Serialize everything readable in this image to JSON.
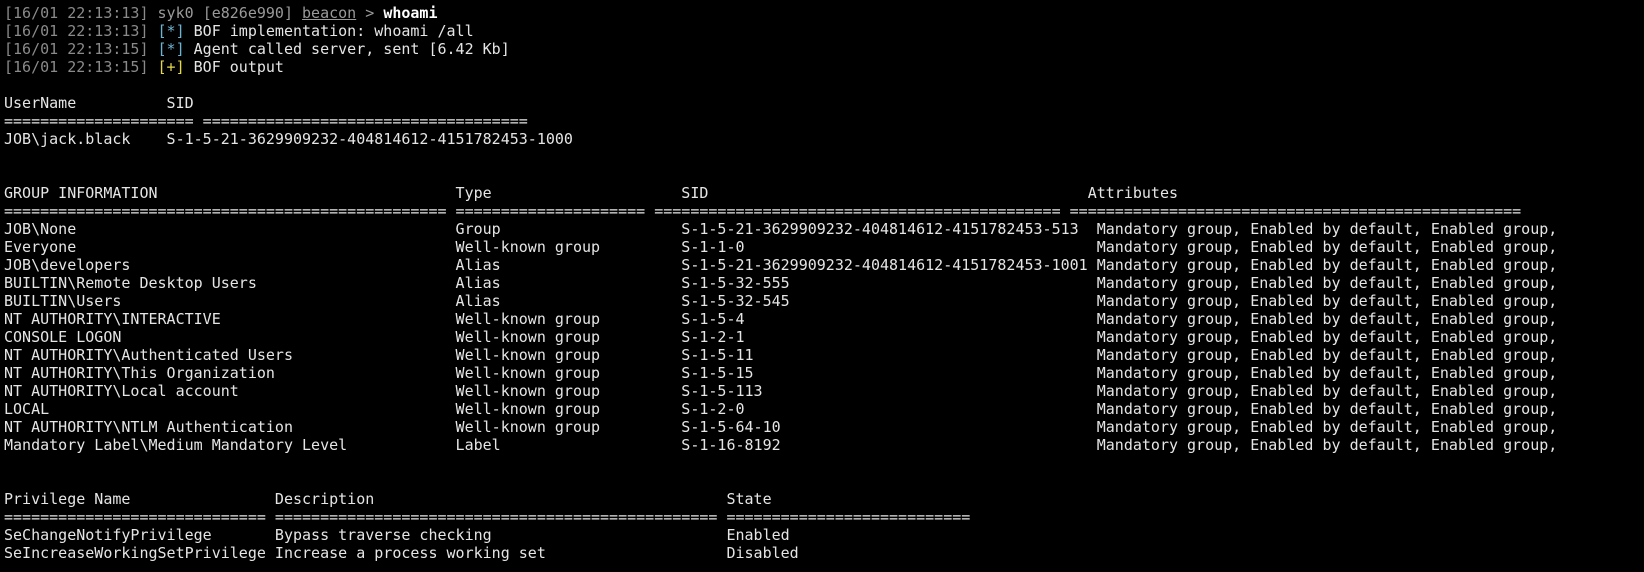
{
  "prompt": {
    "timestamp": "[16/01 22:13:13]",
    "user": "syk0",
    "agent_id": "[e826e990]",
    "module": "beacon",
    "arrow": ">",
    "command": "whoami"
  },
  "log": [
    {
      "timestamp": "[16/01 22:13:13]",
      "marker": "[*]",
      "kind": "info",
      "text": "BOF implementation: whoami /all"
    },
    {
      "timestamp": "[16/01 22:13:15]",
      "marker": "[*]",
      "kind": "info",
      "text": "Agent called server, sent [6.42 Kb]"
    },
    {
      "timestamp": "[16/01 22:13:15]",
      "marker": "[+]",
      "kind": "ok",
      "text": "BOF output"
    }
  ],
  "user_table": {
    "header": "UserName          SID",
    "separator": "===================== ====================================",
    "rows": [
      "JOB\\jack.black    S-1-5-21-3629909232-404814612-4151782453-1000"
    ]
  },
  "group_table": {
    "header": "GROUP INFORMATION                                 Type                     SID                                          Attributes",
    "separator": "================================================= ===================== ============================================= ==================================================",
    "rows": [
      "JOB\\None                                          Group                    S-1-5-21-3629909232-404814612-4151782453-513  Mandatory group, Enabled by default, Enabled group,",
      "Everyone                                          Well-known group         S-1-1-0                                       Mandatory group, Enabled by default, Enabled group,",
      "JOB\\developers                                    Alias                    S-1-5-21-3629909232-404814612-4151782453-1001 Mandatory group, Enabled by default, Enabled group,",
      "BUILTIN\\Remote Desktop Users                      Alias                    S-1-5-32-555                                  Mandatory group, Enabled by default, Enabled group,",
      "BUILTIN\\Users                                     Alias                    S-1-5-32-545                                  Mandatory group, Enabled by default, Enabled group,",
      "NT AUTHORITY\\INTERACTIVE                          Well-known group         S-1-5-4                                       Mandatory group, Enabled by default, Enabled group,",
      "CONSOLE LOGON                                     Well-known group         S-1-2-1                                       Mandatory group, Enabled by default, Enabled group,",
      "NT AUTHORITY\\Authenticated Users                  Well-known group         S-1-5-11                                      Mandatory group, Enabled by default, Enabled group,",
      "NT AUTHORITY\\This Organization                    Well-known group         S-1-5-15                                      Mandatory group, Enabled by default, Enabled group,",
      "NT AUTHORITY\\Local account                        Well-known group         S-1-5-113                                     Mandatory group, Enabled by default, Enabled group,",
      "LOCAL                                             Well-known group         S-1-2-0                                       Mandatory group, Enabled by default, Enabled group,",
      "NT AUTHORITY\\NTLM Authentication                  Well-known group         S-1-5-64-10                                   Mandatory group, Enabled by default, Enabled group,",
      "Mandatory Label\\Medium Mandatory Level            Label                    S-1-16-8192                                   Mandatory group, Enabled by default, Enabled group,"
    ]
  },
  "privilege_table": {
    "header": "Privilege Name                Description                                       State",
    "separator": "============================= ================================================= ===========================",
    "rows": [
      "SeChangeNotifyPrivilege       Bypass traverse checking                          Enabled",
      "SeIncreaseWorkingSetPrivilege Increase a process working set                    Disabled"
    ]
  }
}
